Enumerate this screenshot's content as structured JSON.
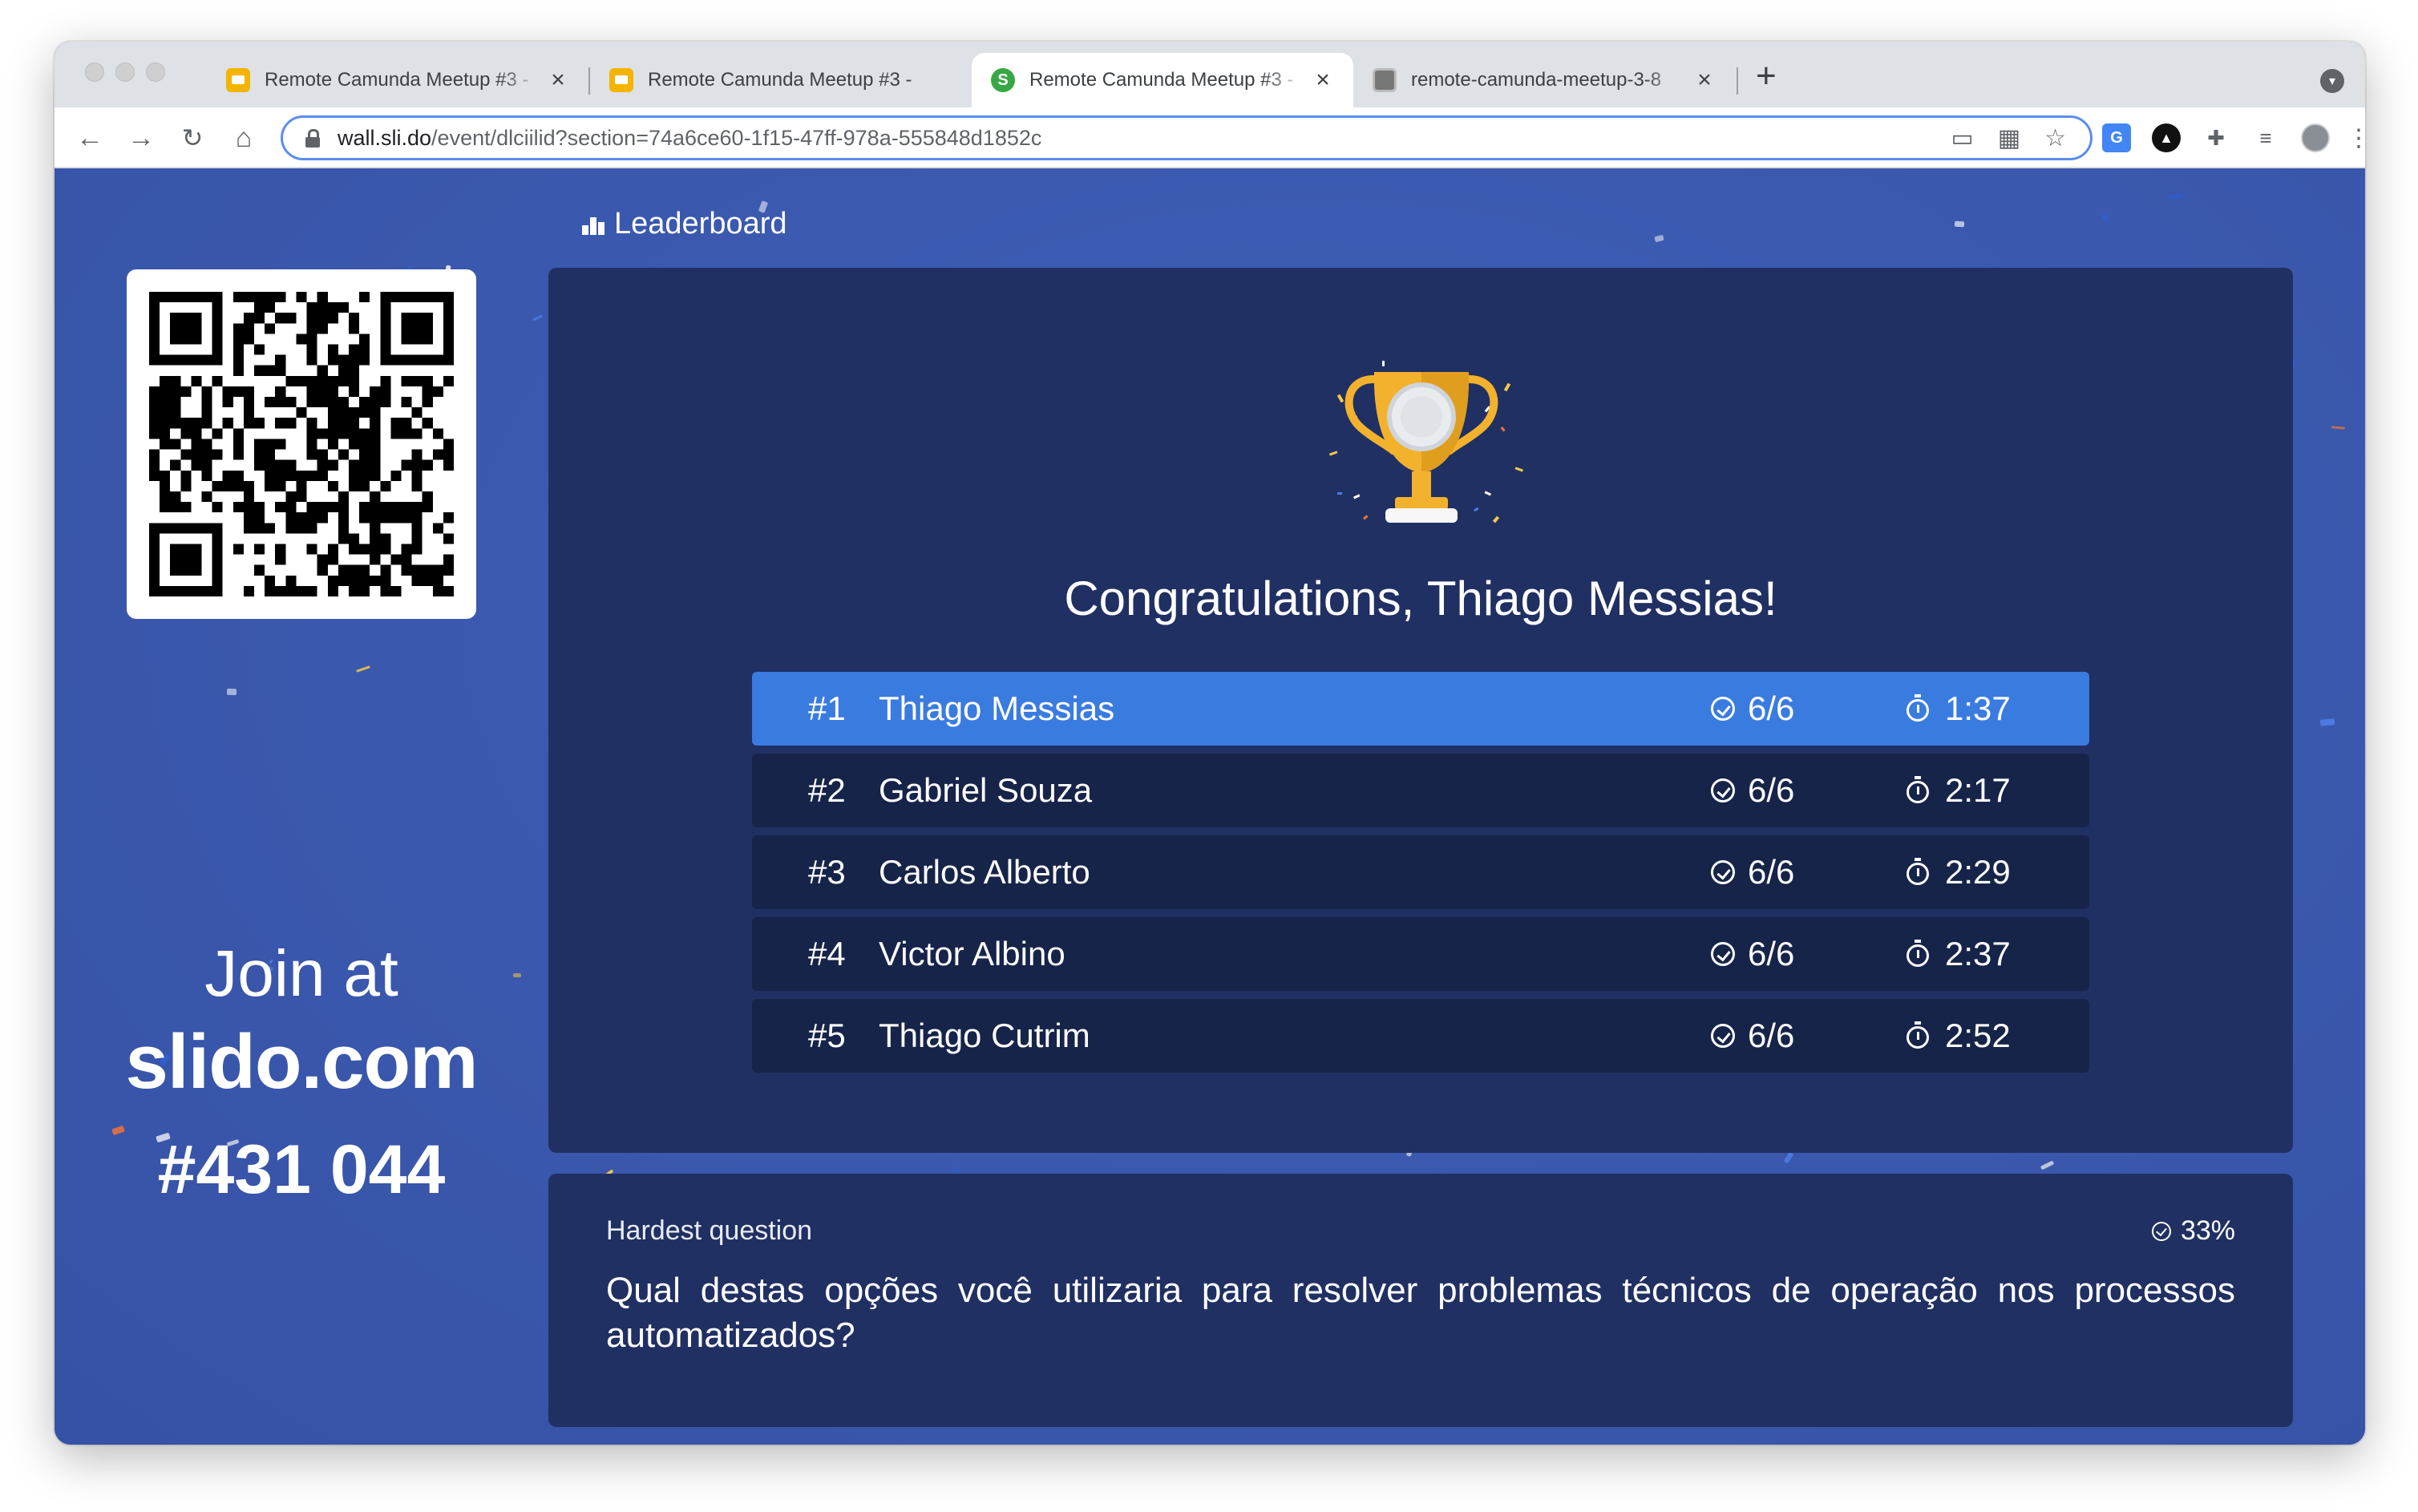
{
  "browser": {
    "tabs": [
      {
        "title": "Remote Camunda Meetup #3 - ",
        "favicon": "google-slides-icon",
        "active": false
      },
      {
        "title": "Remote Camunda Meetup #3 - ",
        "favicon": "google-slides-icon",
        "active": false
      },
      {
        "title": "Remote Camunda Meetup #3 - ",
        "favicon": "slido-icon",
        "active": true
      },
      {
        "title": "remote-camunda-meetup-3-8",
        "favicon": "image-thumbnail-icon",
        "active": false
      }
    ],
    "tab_close_glyph": "×",
    "new_tab_glyph": "+",
    "url_host": "wall.sli.do",
    "url_path": "/event/dlciilid?section=74a6ce60-1f15-47ff-978a-555848d1852c"
  },
  "sidebar": {
    "join_at": "Join at",
    "join_url": "slido.com",
    "event_code": "#431 044"
  },
  "leaderboard": {
    "heading": "Leaderboard",
    "congrats": "Congratulations, Thiago Messias!",
    "rows": [
      {
        "rank": "#1",
        "name": "Thiago Messias",
        "score": "6/6",
        "time": "1:37"
      },
      {
        "rank": "#2",
        "name": "Gabriel Souza",
        "score": "6/6",
        "time": "2:17"
      },
      {
        "rank": "#3",
        "name": "Carlos Alberto",
        "score": "6/6",
        "time": "2:29"
      },
      {
        "rank": "#4",
        "name": "Victor Albino",
        "score": "6/6",
        "time": "2:37"
      },
      {
        "rank": "#5",
        "name": "Thiago Cutrim",
        "score": "6/6",
        "time": "2:52"
      }
    ]
  },
  "hardest_question": {
    "label": "Hardest question",
    "percent": "33%",
    "text": "Qual destas opções você utilizaria para resolver problemas técnicos de operação nos processos automatizados?"
  },
  "colors": {
    "background": "#3a58ad",
    "panel": "#203063",
    "row": "#172449",
    "highlight_row": "#3a7be0",
    "trophy_gold": "#f2b22e"
  }
}
